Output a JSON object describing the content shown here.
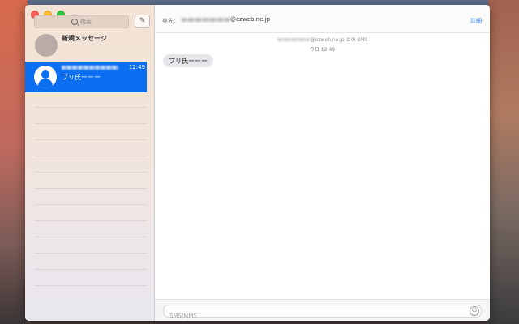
{
  "window": {
    "search_placeholder": "検索",
    "compose_icon": "compose-icon"
  },
  "sidebar": {
    "new_message_label": "新規メッセージ",
    "active_conversation": {
      "time": "12:49",
      "preview": "プリ氏ーーー"
    }
  },
  "header": {
    "to_label": "宛先：",
    "to_domain": "@ezweb.ne.jp",
    "details_label": "詳細"
  },
  "thread": {
    "info_text": "@ezweb.ne.jp との SMS",
    "timestamp": "今日 12:49",
    "message": "プリ氏ーーー"
  },
  "input": {
    "placeholder": "SMS/MMS",
    "emoji_icon": "emoji-icon"
  },
  "colors": {
    "accent": "#0b6ef0",
    "bubble": "#e5e5ea",
    "link": "#2e7bf0"
  }
}
